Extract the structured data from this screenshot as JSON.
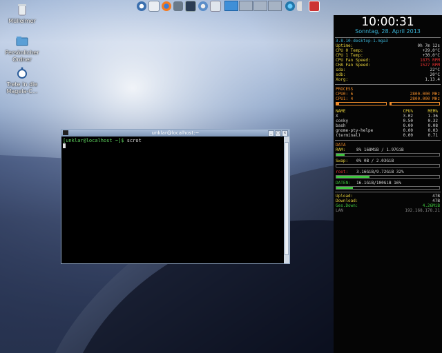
{
  "desktop": {
    "icons": [
      {
        "label": "Mülleimer",
        "icon": "trash-icon"
      },
      {
        "label": "Persönlicher Ordner",
        "icon": "home-folder-icon"
      },
      {
        "label": "Trete in die Magela-C...",
        "icon": "community-icon"
      }
    ]
  },
  "panel": {
    "launchers": [
      "mageia-menu-icon",
      "file-manager-icon",
      "firefox-icon",
      "network-icon",
      "monitor-icon",
      "settings-icon",
      "window-list-icon"
    ],
    "pager_pages": 4,
    "active_page": 1,
    "tray": [
      "network-tray-icon",
      "volume-icon",
      "update-icon"
    ]
  },
  "terminal": {
    "title": "unklar@localhost:~",
    "prompt_user": "[unklar@localhost ~]$",
    "command": "scrot"
  },
  "conky": {
    "time": "10:00:31",
    "date": "Sonntag, 28. April 2013",
    "kernel": "3.8.10-desktop-1.mga3",
    "system": [
      {
        "label": "Uptime:",
        "value": "0h 7m 12s",
        "cls": "yellow",
        "vcls": ""
      },
      {
        "label": "CPU 0 Temp:",
        "value": "+29.0°C",
        "cls": "yellow",
        "vcls": ""
      },
      {
        "label": "CPU 1 Temp:",
        "value": "+30.0°C",
        "cls": "yellow",
        "vcls": ""
      },
      {
        "label": "CPU Fan Speed:",
        "value": "1875 RPM",
        "cls": "yellow",
        "vcls": "red"
      },
      {
        "label": "CHA Fan Speed:",
        "value": "1527 RPM",
        "cls": "yellow",
        "vcls": "red"
      },
      {
        "label": "sda:",
        "value": "22°C",
        "cls": "yellow",
        "vcls": ""
      },
      {
        "label": "sdb:",
        "value": "20°C",
        "cls": "yellow",
        "vcls": ""
      },
      {
        "label": "Xorg:",
        "value": "1.13.4",
        "cls": "yellow",
        "vcls": ""
      }
    ],
    "process_header": "PROCESS",
    "cpus": [
      {
        "label": "CPU0: 6",
        "freq": "2800.000 MHz",
        "usage": 6
      },
      {
        "label": "CPU1: 4",
        "freq": "2800.000 MHz",
        "usage": 4
      }
    ],
    "proc_cols": [
      "NAME",
      "CPU%",
      "MEM%"
    ],
    "procs": [
      {
        "name": "X",
        "cpu": "3.02",
        "mem": "1.36"
      },
      {
        "name": "conky",
        "cpu": "0.50",
        "mem": "0.32"
      },
      {
        "name": "bash",
        "cpu": "0.00",
        "mem": "0.08"
      },
      {
        "name": "gnome-pty-helpe",
        "cpu": "0.00",
        "mem": "0.03"
      },
      {
        "name": "(terminal)",
        "cpu": "0.00",
        "mem": "0.71"
      }
    ],
    "data_header": "DATA",
    "ram": {
      "label": "RAM:",
      "value": "8%  168MiB   / 1.97GiB",
      "usage": 8
    },
    "swap": {
      "label": "Swap:",
      "value": "0%  0B      / 2.03GiB",
      "usage": 0
    },
    "root": {
      "label": "root:",
      "value": "3.16GiB/9.72GiB  32%",
      "usage": 32
    },
    "daten": {
      "label": "DATEN:",
      "value": "16.1GiB/100GiB  16%",
      "usage": 16
    },
    "net": [
      {
        "label": "Upload:",
        "value": "47B",
        "cls": "yellow",
        "vcls": ""
      },
      {
        "label": "Download:",
        "value": "47B",
        "cls": "yellow",
        "vcls": ""
      },
      {
        "label": "Ges.Down:",
        "value": "4.26MiB",
        "cls": "green",
        "vcls": "green"
      },
      {
        "label": "LAN",
        "value": "192.168.178.21",
        "cls": "grey",
        "vcls": "grey"
      }
    ]
  }
}
